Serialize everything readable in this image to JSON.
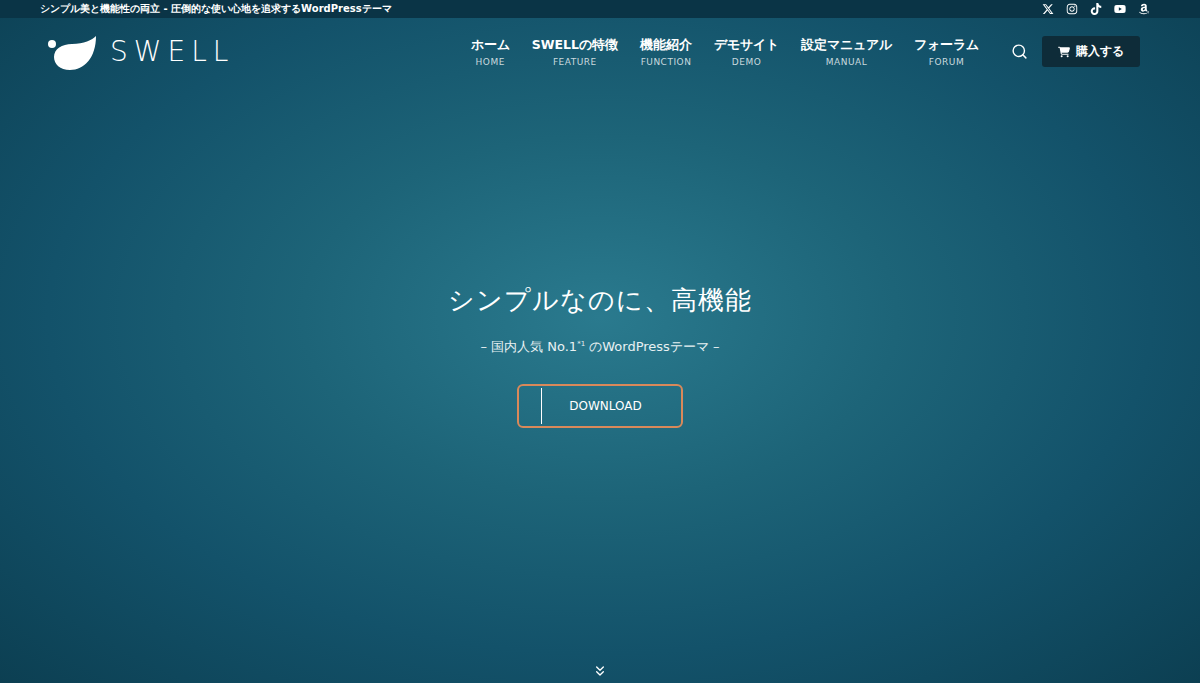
{
  "topbar": {
    "tagline": "シンプル美と機能性の両立 - 圧倒的な使い心地を追求するWordPressテーマ"
  },
  "logo": {
    "text": "SWELL"
  },
  "nav": [
    {
      "label": "ホーム",
      "sub": "HOME"
    },
    {
      "label": "SWELLの特徴",
      "sub": "FEATURE"
    },
    {
      "label": "機能紹介",
      "sub": "FUNCTION"
    },
    {
      "label": "デモサイト",
      "sub": "DEMO"
    },
    {
      "label": "設定マニュアル",
      "sub": "MANUAL"
    },
    {
      "label": "フォーラム",
      "sub": "FORUM"
    }
  ],
  "purchase_button": {
    "label": "購入する"
  },
  "hero": {
    "title": "シンプルなのに、高機能",
    "subtitle_before": "– 国内人気 No.1",
    "subtitle_note": "*1",
    "subtitle_after": " のWordPressテーマ –",
    "button": {
      "label": "DOWNLOAD",
      "highlighted": true
    }
  }
}
